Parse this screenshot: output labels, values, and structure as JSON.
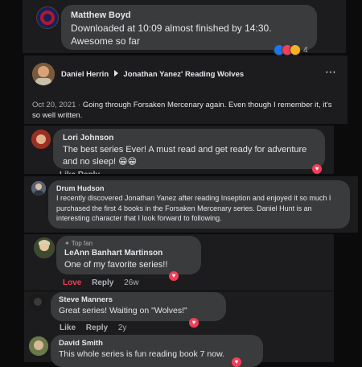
{
  "comments": [
    {
      "author": "Matthew Boyd",
      "text": "Downloaded at 10:09 almost finished by 14:30. Awesome so far",
      "reaction_count": "4"
    }
  ],
  "post": {
    "author": "Daniel Herrin",
    "group": "Jonathan Yanez' Reading Wolves",
    "date": "Oct 20, 2021",
    "separator": "·",
    "text": "Going through Forsaken Mercenary again. Even though I remember it, it's so well written.",
    "more_icon": "⋯"
  },
  "replies": [
    {
      "author": "Lori Johnson",
      "text": "The best series Ever! A must read and get ready for adventure and no sleep! 😁😁",
      "meta_partial": "Like   Reply"
    },
    {
      "author": "Drum Hudson",
      "text": "I recently discovered Jonathan Yanez after reading Inseption and enjoyed it so much I purchased the first 4 books in the Forsaken Mercenary series. Daniel Hunt is an interesting character that I look forward to following."
    },
    {
      "badge": "Top fan",
      "author": "LeAnn Banhart Martinson",
      "text": "One of my favorite series!!",
      "love": "Love",
      "reply": "Reply",
      "time": "26w"
    },
    {
      "author": "Steve Manners",
      "text": "Great series! Waiting on \"Wolves!\"",
      "like": "Like",
      "reply": "Reply",
      "time": "2y"
    },
    {
      "author": "David Smith",
      "text": "This whole series is fun reading book 7 now."
    }
  ],
  "colors": {
    "love": "#f33e58",
    "like_blue": "#1877f2",
    "panel": "#1c1c1e",
    "bubble": "#3a3b3c"
  }
}
